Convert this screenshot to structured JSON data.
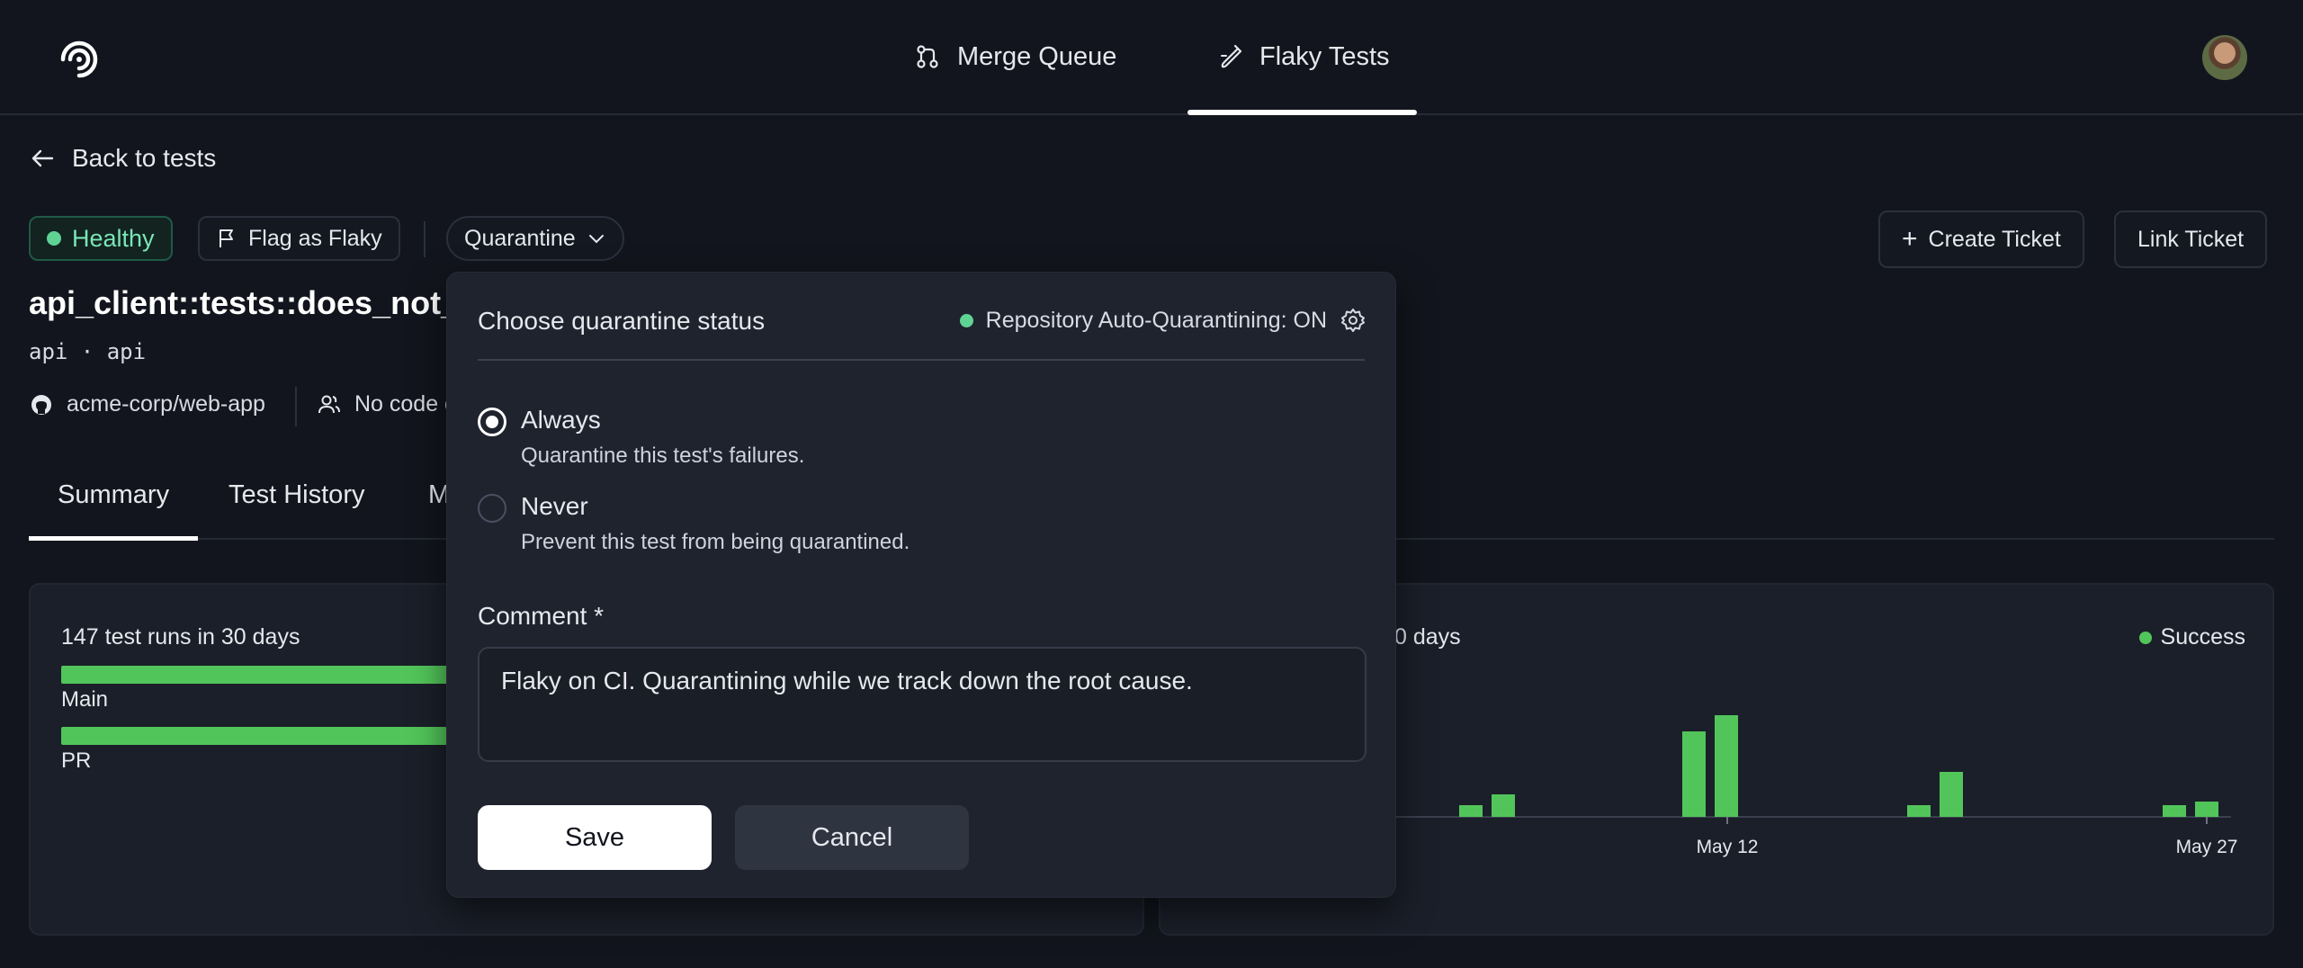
{
  "nav": {
    "tabs": [
      {
        "label": "Merge Queue",
        "icon": "merge-icon"
      },
      {
        "label": "Flaky Tests",
        "icon": "test-tube-icon",
        "active": true
      }
    ]
  },
  "back": {
    "label": "Back to tests"
  },
  "status": {
    "healthy": "Healthy",
    "flag": "Flag as Flaky",
    "quarantine": "Quarantine"
  },
  "actions": {
    "create_ticket": "Create Ticket",
    "link_ticket": "Link Ticket"
  },
  "test": {
    "title": "api_client::tests::does_not_",
    "subtitle": "api · api",
    "repo": "acme-corp/web-app",
    "owners": "No code o"
  },
  "tabs": [
    "Summary",
    "Test History",
    "M"
  ],
  "summary_card": {
    "runs_label": "147 test runs in 30 days",
    "bars": [
      {
        "label": "Main"
      },
      {
        "label": "PR"
      }
    ]
  },
  "chart_card": {
    "label": "0 days",
    "legend": "Success",
    "colors": {
      "success": "#52c55a"
    }
  },
  "chart_data": {
    "type": "bar",
    "series": [
      {
        "name": "Success"
      }
    ],
    "tick_labels": [
      "May 12",
      "May 27"
    ]
  },
  "popover": {
    "title": "Choose quarantine status",
    "auto_status": "Repository Auto-Quarantining: ON",
    "options": [
      {
        "title": "Always",
        "desc": "Quarantine this test's failures.",
        "checked": true
      },
      {
        "title": "Never",
        "desc": "Prevent this test from being quarantined.",
        "checked": false
      }
    ],
    "comment_label": "Comment *",
    "comment_value": "Flaky on CI. Quarantining while we track down the root cause.",
    "save": "Save",
    "cancel": "Cancel"
  }
}
